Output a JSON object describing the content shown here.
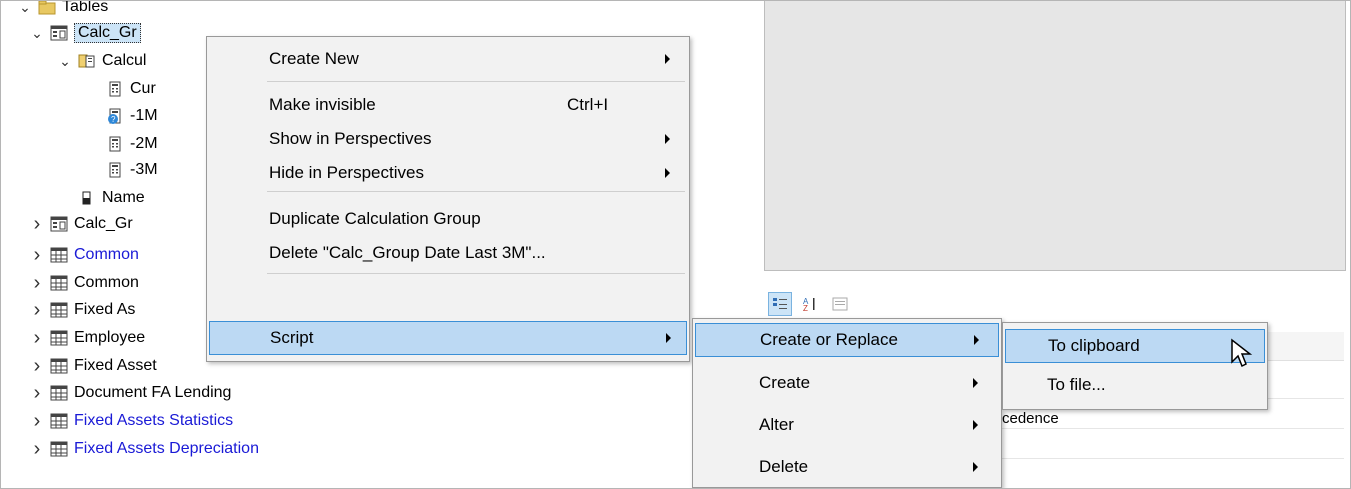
{
  "tree": {
    "header_label": "Tables",
    "items": [
      {
        "label": "Calc_Gr",
        "icon": "calc-table-icon",
        "chevron": "expanded",
        "indent": 1,
        "selected": true
      },
      {
        "label": "Calcul",
        "icon": "calc-column-icon",
        "chevron": "expanded",
        "indent": 2
      },
      {
        "label": "Cur",
        "icon": "calculator-icon",
        "chevron": "none",
        "indent": 3
      },
      {
        "label": "-1M",
        "icon": "calculator-info-icon",
        "chevron": "none",
        "indent": 3
      },
      {
        "label": "-2M",
        "icon": "calculator-icon",
        "chevron": "none",
        "indent": 3
      },
      {
        "label": "-3M",
        "icon": "calculator-icon",
        "chevron": "none",
        "indent": 3
      },
      {
        "label": "Name",
        "icon": "column-icon",
        "chevron": "none",
        "indent": 2
      },
      {
        "label": "Calc_Gr",
        "icon": "calc-table-icon",
        "chevron": "collapsed",
        "indent": 1
      },
      {
        "label": "Common",
        "icon": "table-icon",
        "chevron": "collapsed",
        "indent": 1,
        "blue": true
      },
      {
        "label": "Common",
        "icon": "table-icon",
        "chevron": "collapsed",
        "indent": 1
      },
      {
        "label": "Fixed As",
        "icon": "table-icon",
        "chevron": "collapsed",
        "indent": 1
      },
      {
        "label": "Employee",
        "icon": "table-icon",
        "chevron": "collapsed",
        "indent": 1
      },
      {
        "label": "Fixed Asset",
        "icon": "table-icon",
        "chevron": "collapsed",
        "indent": 1
      },
      {
        "label": "Document FA Lending",
        "icon": "table-icon",
        "chevron": "collapsed",
        "indent": 1
      },
      {
        "label": "Fixed Assets Statistics",
        "icon": "table-icon",
        "chevron": "collapsed",
        "indent": 1,
        "blue": true
      },
      {
        "label": "Fixed Assets Depreciation",
        "icon": "table-icon",
        "chevron": "collapsed",
        "indent": 1,
        "blue": true
      }
    ]
  },
  "properties": {
    "partial_text": "cedence"
  },
  "context_menu": {
    "items": [
      {
        "label": "Create New",
        "shortcut": "",
        "submenu": true
      },
      {
        "label": "Make invisible",
        "shortcut": "Ctrl+I",
        "submenu": false
      },
      {
        "label": "Show in Perspectives",
        "shortcut": "",
        "submenu": true
      },
      {
        "label": "Hide in Perspectives",
        "shortcut": "",
        "submenu": true
      },
      {
        "label": "Duplicate Calculation Group",
        "shortcut": "",
        "submenu": false
      },
      {
        "label": "Delete \"Calc_Group Date Last 3M\"...",
        "shortcut": "",
        "submenu": false
      },
      {
        "label": "Script",
        "shortcut": "",
        "submenu": true,
        "highlighted": true
      }
    ]
  },
  "script_menu": {
    "items": [
      {
        "label": "Create or Replace",
        "submenu": true,
        "highlighted": true
      },
      {
        "label": "Create",
        "submenu": true
      },
      {
        "label": "Alter",
        "submenu": true
      },
      {
        "label": "Delete",
        "submenu": true
      }
    ]
  },
  "create_replace_menu": {
    "items": [
      {
        "label": "To clipboard",
        "highlighted": true
      },
      {
        "label": "To file..."
      }
    ]
  },
  "colors": {
    "highlight": "#bcd9f3",
    "highlight_border": "#3a8fd6",
    "link_blue": "#1a1ad6",
    "menu_bg": "#f2f2f2"
  }
}
